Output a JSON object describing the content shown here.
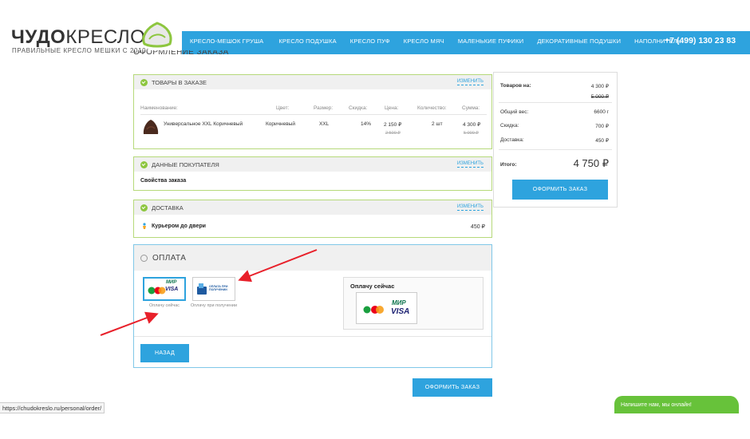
{
  "header": {
    "logo_bold": "ЧУДО",
    "logo_rest": "КРЕСЛО",
    "logo_tagline": "ПРАВИЛЬНЫЕ КРЕСЛО МЕШКИ С 2010г",
    "nav": [
      "КРЕСЛО-МЕШОК ГРУША",
      "КРЕСЛО ПОДУШКА",
      "КРЕСЛО ПУФ",
      "КРЕСЛО МЯЧ",
      "МАЛЕНЬКИЕ ПУФИКИ",
      "ДЕКОРАТИВНЫЕ ПОДУШКИ",
      "НАПОЛНИТЕЛЬ"
    ],
    "phone": "+7 (499) 130 23 83",
    "accent_color": "#2ea3de"
  },
  "page_title": "ОФОРМЛЕНИЕ ЗАКАЗА",
  "goods": {
    "title": "ТОВАРЫ В ЗАКАЗЕ",
    "change": "изменить",
    "columns": [
      "Наименование:",
      "Цвет:",
      "Размер:",
      "Скидка:",
      "Цена:",
      "Количество:",
      "Сумма:"
    ],
    "item": {
      "name": "Универсальное XXL Коричневый",
      "color": "Коричневый",
      "size": "XXL",
      "discount": "14%",
      "price": "2 150 ₽",
      "old_price": "2 500 ₽",
      "qty": "2 шт",
      "sum": "4 300 ₽",
      "old_sum": "5 000 ₽"
    }
  },
  "buyer": {
    "title": "ДАННЫЕ ПОКУПАТЕЛЯ",
    "change": "изменить",
    "props": "Свойства заказа"
  },
  "delivery": {
    "title": "ДОСТАВКА",
    "change": "изменить",
    "method": "Курьером до двери",
    "price": "450 ₽"
  },
  "payment": {
    "title": "ОПЛАТА",
    "options": [
      {
        "label": "Оплачу сейчас",
        "selected": true
      },
      {
        "label": "Оплачу при получении",
        "selected": false
      }
    ],
    "card_text": "ОПЛАТА ПРИ ПОЛУЧЕНИИ",
    "mir": "МИР",
    "visa": "VISA",
    "selected_title": "Оплачу сейчас",
    "back_button": "НАЗАД"
  },
  "submit_bottom": "ОФОРМИТЬ ЗАКАЗ",
  "summary": {
    "goods_label": "Товаров на:",
    "goods_value": "4 300 ₽",
    "goods_old": "5 000 ₽",
    "weight_label": "Общий вес:",
    "weight_value": "6600 г",
    "discount_label": "Скидка:",
    "discount_value": "700 ₽",
    "delivery_label": "Доставка:",
    "delivery_value": "450 ₽",
    "total_label": "Итого:",
    "total_value": "4 750 ₽",
    "submit": "ОФОРМИТЬ ЗАКАЗ"
  },
  "status_url": "https://chudokreslo.ru/personal/order/",
  "chat": "Напишите нам, мы онлайн!"
}
